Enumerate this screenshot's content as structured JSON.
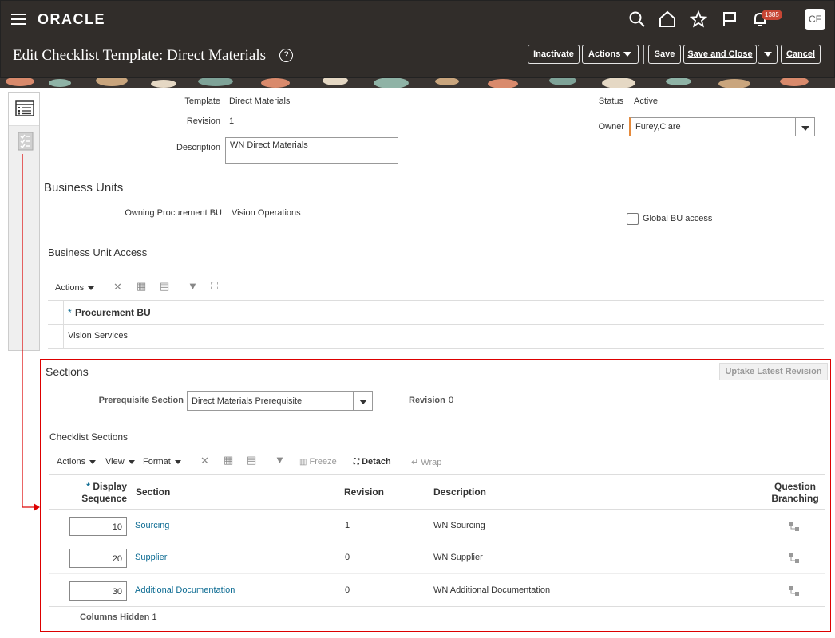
{
  "app": {
    "logo": "ORACLE",
    "notifications_count": "1385",
    "user_initials": "CF"
  },
  "page": {
    "title": "Edit Checklist Template: Direct Materials",
    "help": "?"
  },
  "toolbar": {
    "inactivate": "Inactivate",
    "actions": "Actions",
    "save": "Save",
    "save_and_close": "Save and Close",
    "cancel": "Cancel"
  },
  "header": {
    "template_label": "Template",
    "template_value": "Direct Materials",
    "revision_label": "Revision",
    "revision_value": "1",
    "description_label": "Description",
    "description_value": "WN Direct Materials",
    "status_label": "Status",
    "status_value": "Active",
    "owner_label": "Owner",
    "owner_value": "Furey,Clare"
  },
  "business_units": {
    "title": "Business Units",
    "owning_label": "Owning Procurement BU",
    "owning_value": "Vision Operations",
    "global_access_label": "Global BU access"
  },
  "bu_access": {
    "title": "Business Unit Access",
    "actions": "Actions",
    "column_header": "Procurement BU",
    "required_mark": "*",
    "rows": [
      "Vision Services"
    ]
  },
  "sections": {
    "title": "Sections",
    "uptake_button": "Uptake Latest Revision",
    "prereq_label": "Prerequisite Section",
    "prereq_value": "Direct Materials Prerequisite",
    "revision_label": "Revision",
    "revision_value": "0"
  },
  "checklist_sections": {
    "title": "Checklist Sections",
    "toolbar": {
      "actions": "Actions",
      "view": "View",
      "format": "Format",
      "freeze": "Freeze",
      "detach": "Detach",
      "wrap": "Wrap"
    },
    "columns": {
      "display_sequence_1": "Display",
      "display_sequence_2": "Sequence",
      "required_mark": "*",
      "section": "Section",
      "revision": "Revision",
      "description": "Description",
      "branching_1": "Question",
      "branching_2": "Branching"
    },
    "rows": [
      {
        "sequence": "10",
        "section": "Sourcing",
        "revision": "1",
        "description": "WN Sourcing"
      },
      {
        "sequence": "20",
        "section": "Supplier",
        "revision": "0",
        "description": "WN Supplier"
      },
      {
        "sequence": "30",
        "section": "Additional Documentation",
        "revision": "0",
        "description": "WN Additional Documentation"
      }
    ],
    "columns_hidden_label": "Columns Hidden",
    "columns_hidden_value": "1"
  },
  "colors": {
    "header_bg": "#312d2a",
    "link": "#0e6c93",
    "highlight_box": "#dd0000",
    "badge": "#c74634"
  }
}
